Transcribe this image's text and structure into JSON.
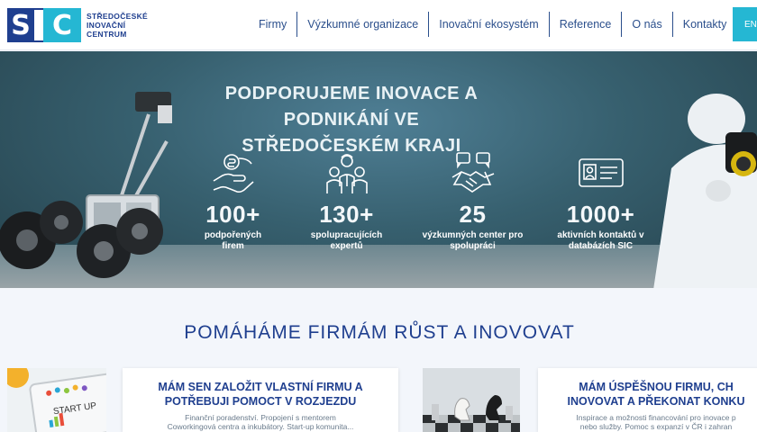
{
  "logo": {
    "mark_s": "S",
    "mark_c": "C",
    "text_lines": [
      "STŘEDOČESKÉ",
      "INOVAČNÍ",
      "CENTRUM"
    ]
  },
  "nav": {
    "items": [
      "Firmy",
      "Výzkumné organizace",
      "Inovační ekosystém",
      "Reference",
      "O nás",
      "Kontakty"
    ]
  },
  "lang": "EN",
  "hero": {
    "title_line1": "PODPORUJEME INOVACE A PODNIKÁNÍ VE",
    "title_line2": "STŘEDOČESKÉM KRAJI",
    "stats": [
      {
        "value": "100+",
        "label_line1": "podpořených",
        "label_line2": "firem",
        "icon": "money-hand-icon"
      },
      {
        "value": "130+",
        "label_line1": "spolupracujících",
        "label_line2": "expertů",
        "icon": "experts-group-icon"
      },
      {
        "value": "25",
        "label_line1": "výzkumných center pro",
        "label_line2": "spolupráci",
        "icon": "handshake-icon"
      },
      {
        "value": "1000+",
        "label_line1": "aktivních kontaktů v",
        "label_line2": "databázích SIC",
        "icon": "id-card-icon"
      }
    ]
  },
  "section": {
    "title": "POMÁHÁME FIRMÁM RŮST A INOVOVAT"
  },
  "cards": [
    {
      "title_line1": "MÁM SEN ZALOŽIT VLASTNÍ FIRMU A",
      "title_line2": "POTŘEBUJI POMOCT V ROZJEZDU",
      "desc_line1": "Finanční poradenství. Propojení s mentorem",
      "desc_line2": "Coworkingová centra a inkubátory. Start-up komunita...",
      "image_text": "START UP"
    },
    {
      "title_line1": "MÁM ÚSPĚŠNOU FIRMU, CH",
      "title_line2": "INOVOVAT A PŘEKONAT KONKU",
      "desc_line1": "Inspirace a možnosti financování pro inovace p",
      "desc_line2": "nebo služby. Pomoc s expanzí v ČR i zahran"
    }
  ]
}
